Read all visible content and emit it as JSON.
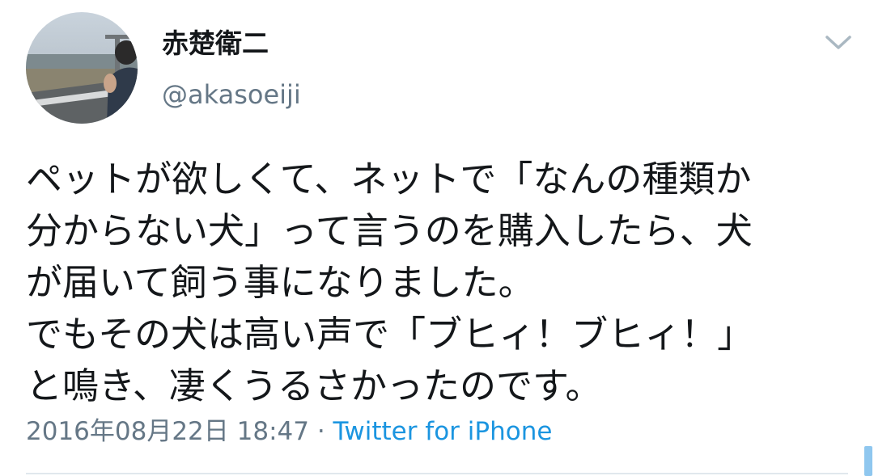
{
  "tweet": {
    "author": {
      "display_name": "赤楚衛二",
      "handle": "@akasoeiji"
    },
    "text_lines": [
      "ペットが欲しくて、ネットで「なんの種類か",
      "分からない犬」って言うのを購入したら、犬",
      "が届いて飼う事になりました。",
      "でもその犬は高い声で「ブヒィ！ブヒィ！」",
      "と鳴き、凄くうるさかったのです。"
    ],
    "timestamp": "2016年08月22日 18:47",
    "separator": " · ",
    "source": "Twitter for iPhone"
  },
  "icons": {
    "menu": "chevron-down-icon"
  },
  "colors": {
    "text": "#14171a",
    "secondary_text": "#657786",
    "link": "#1b95e0",
    "divider": "#e1e8ed"
  }
}
